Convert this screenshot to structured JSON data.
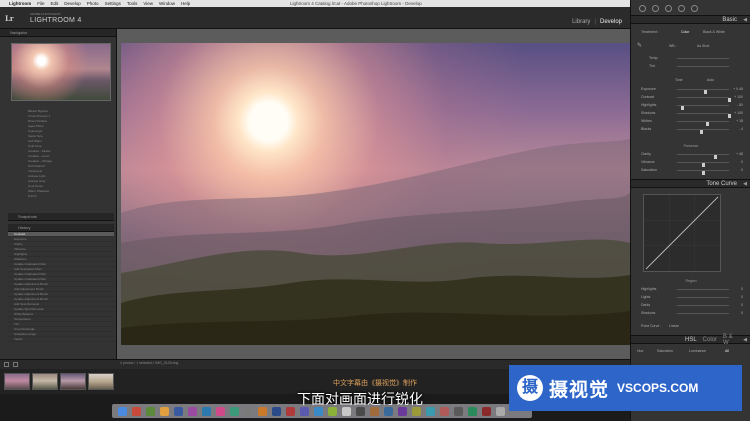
{
  "menubar": {
    "app": "Lightroom",
    "items": [
      "File",
      "Edit",
      "Develop",
      "Photo",
      "Settings",
      "Tools",
      "View",
      "Window",
      "Help"
    ],
    "document_title": "Lightroom 4 Catalog.lrcat - Adobe Photoshop Lightroom - Develop"
  },
  "topbar": {
    "logo": "Lr",
    "vendor": "ADOBE PHOTOSHOP",
    "product": "LIGHTROOM 4",
    "modules": [
      "Library",
      "|",
      "Develop"
    ]
  },
  "left_panel": {
    "navigator_label": "Navigator",
    "presets": [
      "Bleach Bypass",
      "Cross Process 1",
      "Direct Positive",
      "Aged Photo",
      "Cyanotype",
      "Sepia Tone",
      "Soft Warm",
      "Cold Tone",
      "Creative - Faded",
      "Creative - Lomo",
      "Creative - Vintage",
      "Old Polaroid",
      "Yesteryear",
      "Antique Light",
      "Antique Gray",
      "Cool Tones",
      "Warm Shadows",
      "Punch"
    ],
    "snapshots_label": "Snapshots",
    "history_label": "History",
    "history_items": [
      "Contrast",
      "Exposure",
      "Clarity",
      "Vibrance",
      "Highlights",
      "Shadows",
      "Update Graduated Filter",
      "Add Graduated Filter",
      "Update Graduated Filter",
      "Update Graduated Filter",
      "Update Adjustment Brush",
      "Add Adjustment Brush",
      "Update Adjustment Brush",
      "Update Adjustment Brush",
      "Add Spot Removal",
      "Update Spot Removal",
      "White Balance",
      "Temperature",
      "Tint",
      "Crop Rectangle",
      "Straighten Angle",
      "Import"
    ],
    "copy_label": "Copy...",
    "paste_label": "Paste"
  },
  "filmstrip": {
    "info": "4 photos / 1 selected / IMG_0139.dng"
  },
  "subtitle": {
    "line1": "中文字幕由《摄视觉》制作",
    "line2": "下面对画面进行锐化"
  },
  "right_panel": {
    "basic_label": "Basic",
    "treatment_label": "Treatment :",
    "color_label": "Color",
    "bw_label": "Black & White",
    "wb_label": "WB :",
    "wb_value": "As Shot",
    "temp_label": "Temp",
    "tint_label": "Tint",
    "tone_label": "Tone",
    "auto_label": "Auto",
    "sliders": [
      {
        "label": "Exposure",
        "value": "+ 0.45",
        "level": 0.55
      },
      {
        "label": "Contrast",
        "value": "+ 100",
        "level": 1.0
      },
      {
        "label": "Highlights",
        "value": "- 80",
        "level": 0.1
      },
      {
        "label": "Shadows",
        "value": "+ 100",
        "level": 1.0
      },
      {
        "label": "Whites",
        "value": "+ 18",
        "level": 0.59
      },
      {
        "label": "Blacks",
        "value": "- 4",
        "level": 0.48
      }
    ],
    "presence_label": "Presence",
    "presence": [
      {
        "label": "Clarity",
        "value": "+ 48",
        "level": 0.74
      },
      {
        "label": "Vibrance",
        "value": "0",
        "level": 0.5
      },
      {
        "label": "Saturation",
        "value": "0",
        "level": 0.5
      }
    ],
    "tone_curve_label": "Tone Curve",
    "region_label": "Region",
    "region": [
      {
        "label": "Highlights",
        "value": "0"
      },
      {
        "label": "Lights",
        "value": "0"
      },
      {
        "label": "Darks",
        "value": "0"
      },
      {
        "label": "Shadows",
        "value": "0"
      }
    ],
    "point_curve_label": "Point Curve :",
    "point_curve_value": "Linear",
    "hsl_label": "HSL",
    "color_tab": "Color",
    "bw_tab": "B & W",
    "hsl_tabs": [
      "Hue",
      "Saturation",
      "Luminance",
      "All"
    ]
  },
  "watermark": {
    "logo": "摄",
    "cn": "摄视觉",
    "en": "VSCOPS.COM"
  },
  "colors": {
    "accent": "#2e65c9",
    "subtitle_orange": "#e0a25c"
  }
}
